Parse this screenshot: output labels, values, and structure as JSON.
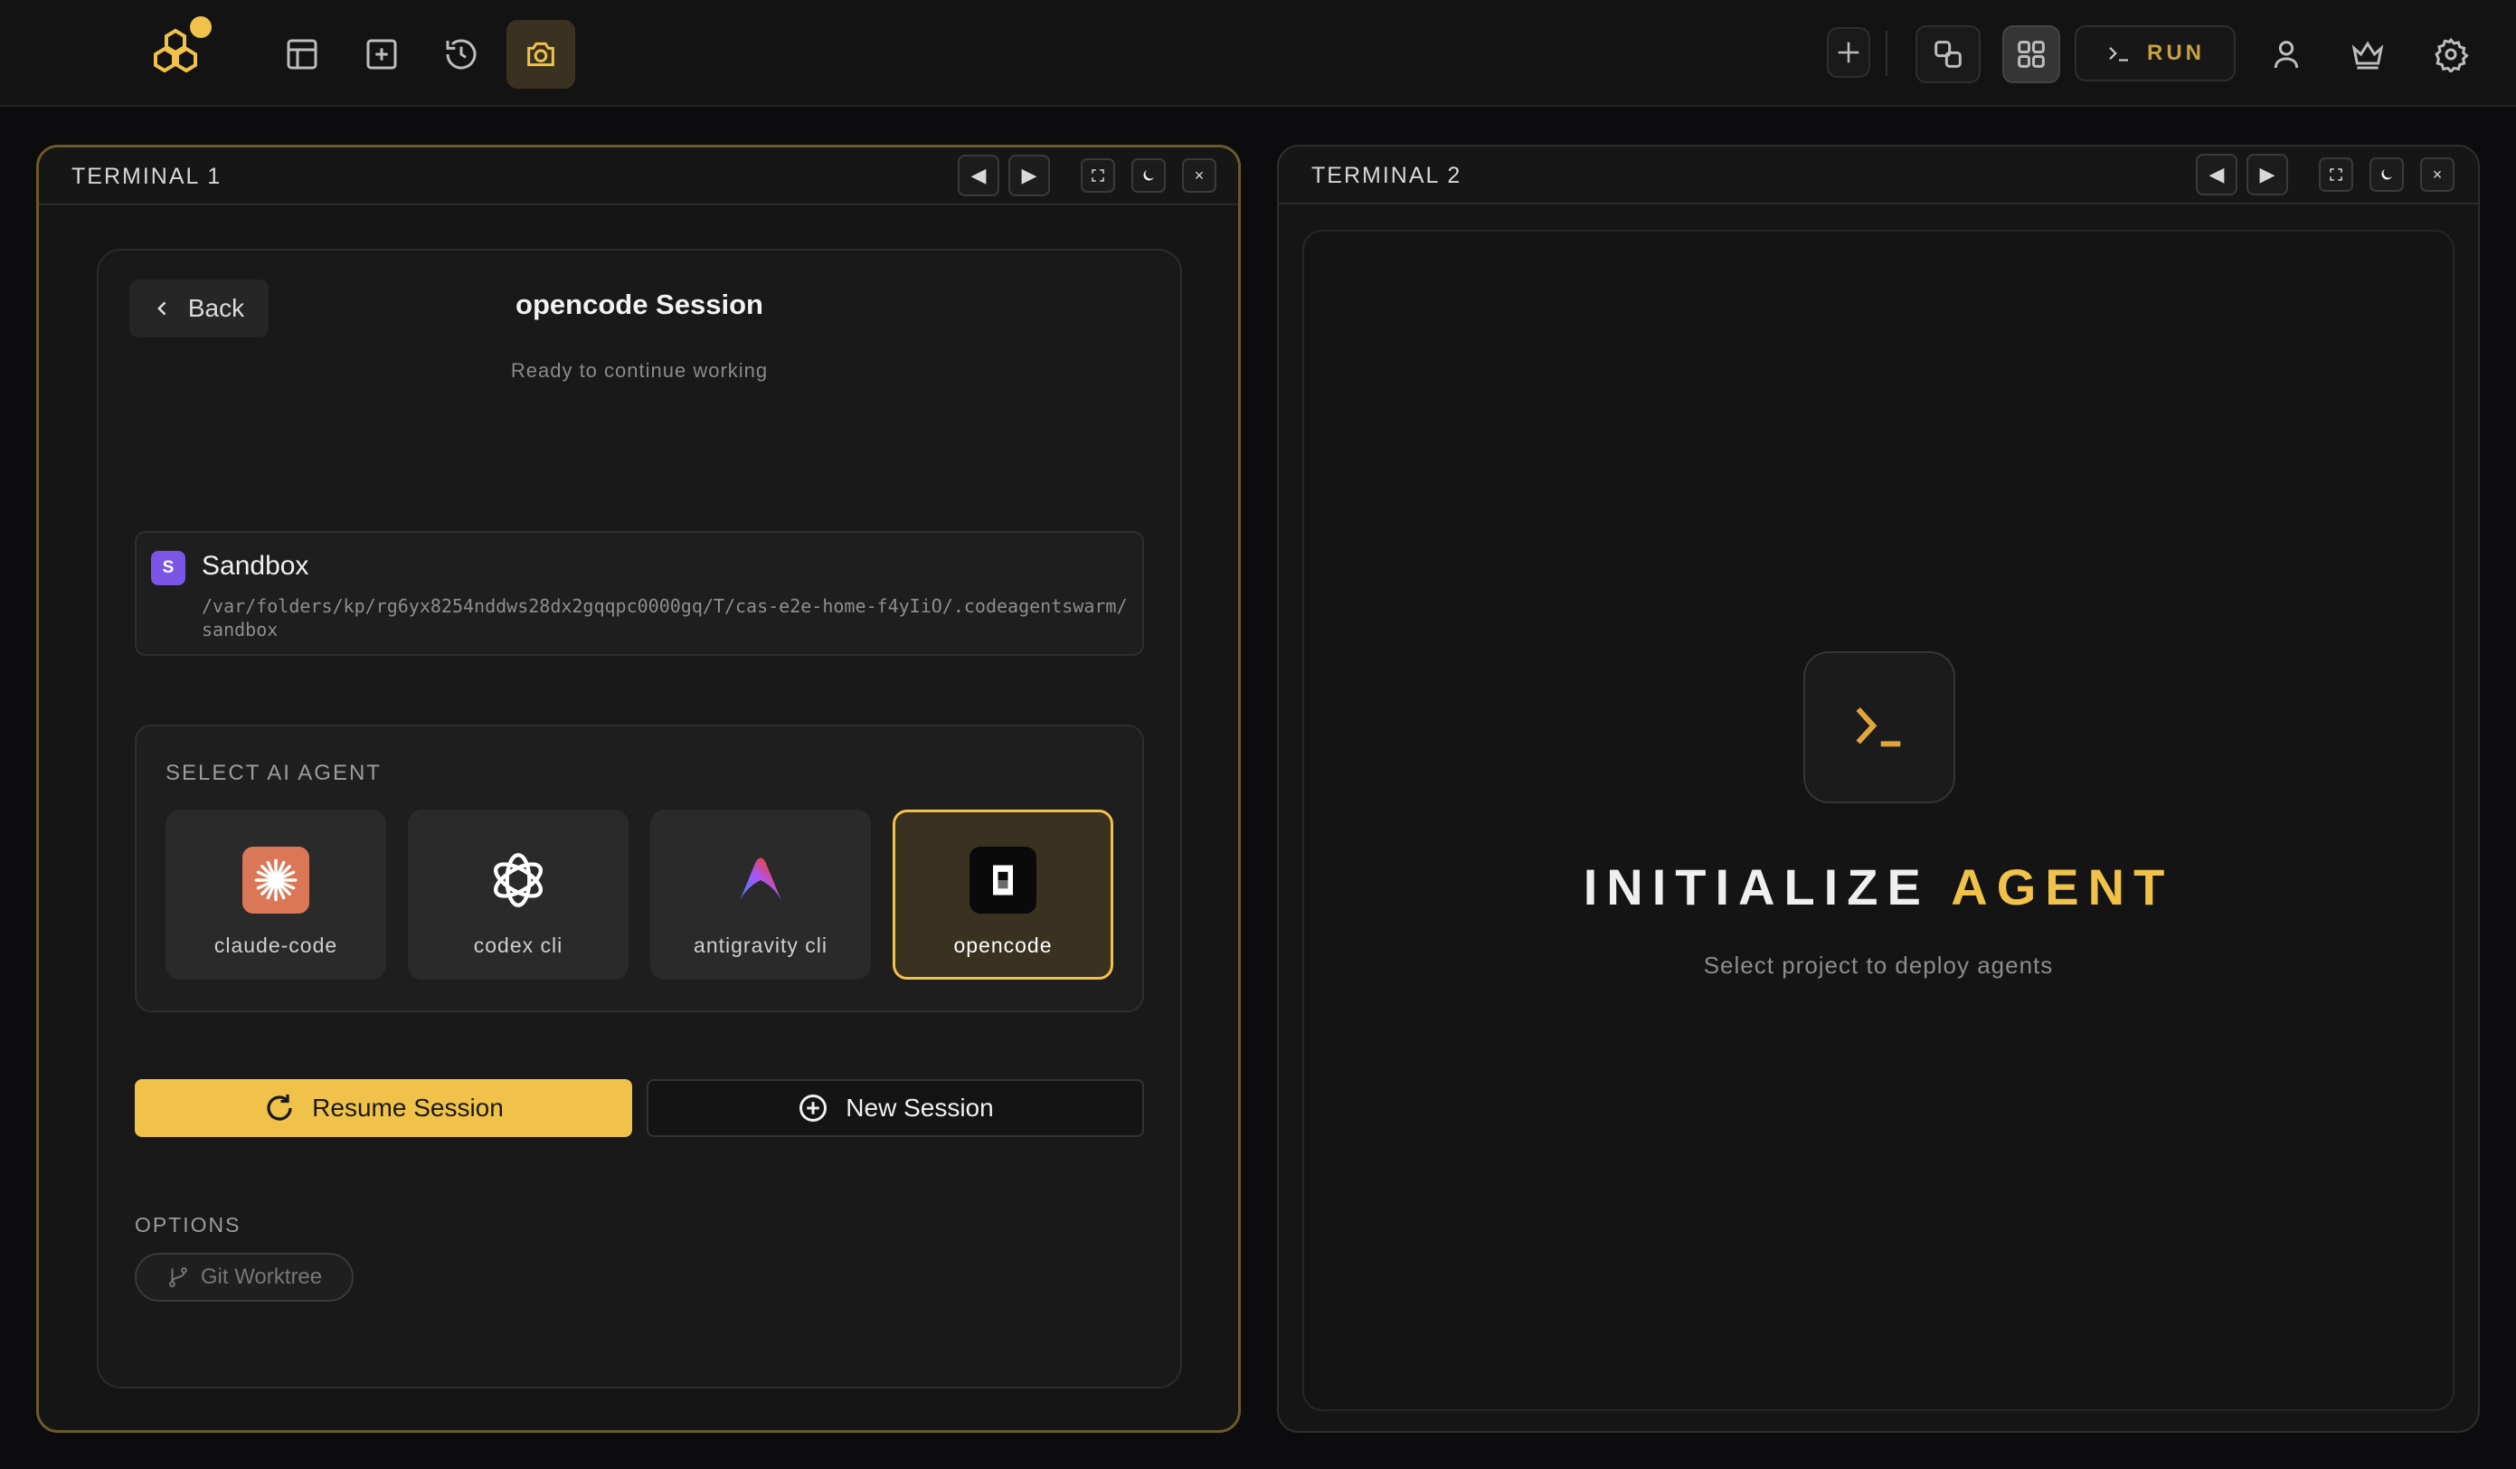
{
  "toolbar": {
    "run_label": "RUN"
  },
  "terminal1": {
    "title": "TERMINAL 1",
    "prev_glyph": "◀",
    "next_glyph": "▶",
    "close_glyph": "×",
    "card": {
      "back_label": "Back",
      "title": "opencode Session",
      "subtitle": "Ready to continue working",
      "workspace": {
        "badge": "S",
        "name": "Sandbox",
        "path": "/var/folders/kp/rg6yx8254nddws28dx2gqqpc0000gq/T/cas-e2e-home-f4yIiO/.codeagentswarm/sandbox"
      },
      "agent_section_label": "SELECT AI AGENT",
      "agents": [
        {
          "name": "claude-code",
          "icon": "claude-icon"
        },
        {
          "name": "codex cli",
          "icon": "openai-icon"
        },
        {
          "name": "antigravity cli",
          "icon": "antigravity-icon"
        },
        {
          "name": "opencode",
          "icon": "opencode-icon",
          "selected": true
        }
      ],
      "resume_label": "Resume Session",
      "new_label": "New Session",
      "options_label": "OPTIONS",
      "git_worktree_label": "Git Worktree"
    }
  },
  "terminal2": {
    "title": "TERMINAL 2",
    "prev_glyph": "◀",
    "next_glyph": "▶",
    "close_glyph": "×",
    "init_title_main": "INITIALIZE ",
    "init_title_accent": "AGENT",
    "init_subtitle": "Select project to deploy agents"
  },
  "colors": {
    "accent": "#f0c24a",
    "background": "#0c0c0e",
    "panel": "#151515",
    "badge_purple": "#7b56e6",
    "claude_orange": "#d97757"
  }
}
